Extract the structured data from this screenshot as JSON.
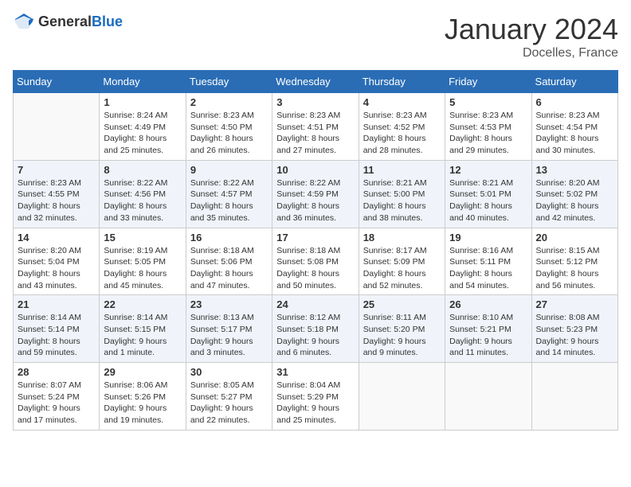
{
  "header": {
    "logo_general": "General",
    "logo_blue": "Blue",
    "month_title": "January 2024",
    "location": "Docelles, France"
  },
  "weekdays": [
    "Sunday",
    "Monday",
    "Tuesday",
    "Wednesday",
    "Thursday",
    "Friday",
    "Saturday"
  ],
  "weeks": [
    [
      {
        "day": "",
        "info": ""
      },
      {
        "day": "1",
        "info": "Sunrise: 8:24 AM\nSunset: 4:49 PM\nDaylight: 8 hours\nand 25 minutes."
      },
      {
        "day": "2",
        "info": "Sunrise: 8:23 AM\nSunset: 4:50 PM\nDaylight: 8 hours\nand 26 minutes."
      },
      {
        "day": "3",
        "info": "Sunrise: 8:23 AM\nSunset: 4:51 PM\nDaylight: 8 hours\nand 27 minutes."
      },
      {
        "day": "4",
        "info": "Sunrise: 8:23 AM\nSunset: 4:52 PM\nDaylight: 8 hours\nand 28 minutes."
      },
      {
        "day": "5",
        "info": "Sunrise: 8:23 AM\nSunset: 4:53 PM\nDaylight: 8 hours\nand 29 minutes."
      },
      {
        "day": "6",
        "info": "Sunrise: 8:23 AM\nSunset: 4:54 PM\nDaylight: 8 hours\nand 30 minutes."
      }
    ],
    [
      {
        "day": "7",
        "info": "Sunrise: 8:23 AM\nSunset: 4:55 PM\nDaylight: 8 hours\nand 32 minutes."
      },
      {
        "day": "8",
        "info": "Sunrise: 8:22 AM\nSunset: 4:56 PM\nDaylight: 8 hours\nand 33 minutes."
      },
      {
        "day": "9",
        "info": "Sunrise: 8:22 AM\nSunset: 4:57 PM\nDaylight: 8 hours\nand 35 minutes."
      },
      {
        "day": "10",
        "info": "Sunrise: 8:22 AM\nSunset: 4:59 PM\nDaylight: 8 hours\nand 36 minutes."
      },
      {
        "day": "11",
        "info": "Sunrise: 8:21 AM\nSunset: 5:00 PM\nDaylight: 8 hours\nand 38 minutes."
      },
      {
        "day": "12",
        "info": "Sunrise: 8:21 AM\nSunset: 5:01 PM\nDaylight: 8 hours\nand 40 minutes."
      },
      {
        "day": "13",
        "info": "Sunrise: 8:20 AM\nSunset: 5:02 PM\nDaylight: 8 hours\nand 42 minutes."
      }
    ],
    [
      {
        "day": "14",
        "info": "Sunrise: 8:20 AM\nSunset: 5:04 PM\nDaylight: 8 hours\nand 43 minutes."
      },
      {
        "day": "15",
        "info": "Sunrise: 8:19 AM\nSunset: 5:05 PM\nDaylight: 8 hours\nand 45 minutes."
      },
      {
        "day": "16",
        "info": "Sunrise: 8:18 AM\nSunset: 5:06 PM\nDaylight: 8 hours\nand 47 minutes."
      },
      {
        "day": "17",
        "info": "Sunrise: 8:18 AM\nSunset: 5:08 PM\nDaylight: 8 hours\nand 50 minutes."
      },
      {
        "day": "18",
        "info": "Sunrise: 8:17 AM\nSunset: 5:09 PM\nDaylight: 8 hours\nand 52 minutes."
      },
      {
        "day": "19",
        "info": "Sunrise: 8:16 AM\nSunset: 5:11 PM\nDaylight: 8 hours\nand 54 minutes."
      },
      {
        "day": "20",
        "info": "Sunrise: 8:15 AM\nSunset: 5:12 PM\nDaylight: 8 hours\nand 56 minutes."
      }
    ],
    [
      {
        "day": "21",
        "info": "Sunrise: 8:14 AM\nSunset: 5:14 PM\nDaylight: 8 hours\nand 59 minutes."
      },
      {
        "day": "22",
        "info": "Sunrise: 8:14 AM\nSunset: 5:15 PM\nDaylight: 9 hours\nand 1 minute."
      },
      {
        "day": "23",
        "info": "Sunrise: 8:13 AM\nSunset: 5:17 PM\nDaylight: 9 hours\nand 3 minutes."
      },
      {
        "day": "24",
        "info": "Sunrise: 8:12 AM\nSunset: 5:18 PM\nDaylight: 9 hours\nand 6 minutes."
      },
      {
        "day": "25",
        "info": "Sunrise: 8:11 AM\nSunset: 5:20 PM\nDaylight: 9 hours\nand 9 minutes."
      },
      {
        "day": "26",
        "info": "Sunrise: 8:10 AM\nSunset: 5:21 PM\nDaylight: 9 hours\nand 11 minutes."
      },
      {
        "day": "27",
        "info": "Sunrise: 8:08 AM\nSunset: 5:23 PM\nDaylight: 9 hours\nand 14 minutes."
      }
    ],
    [
      {
        "day": "28",
        "info": "Sunrise: 8:07 AM\nSunset: 5:24 PM\nDaylight: 9 hours\nand 17 minutes."
      },
      {
        "day": "29",
        "info": "Sunrise: 8:06 AM\nSunset: 5:26 PM\nDaylight: 9 hours\nand 19 minutes."
      },
      {
        "day": "30",
        "info": "Sunrise: 8:05 AM\nSunset: 5:27 PM\nDaylight: 9 hours\nand 22 minutes."
      },
      {
        "day": "31",
        "info": "Sunrise: 8:04 AM\nSunset: 5:29 PM\nDaylight: 9 hours\nand 25 minutes."
      },
      {
        "day": "",
        "info": ""
      },
      {
        "day": "",
        "info": ""
      },
      {
        "day": "",
        "info": ""
      }
    ]
  ]
}
